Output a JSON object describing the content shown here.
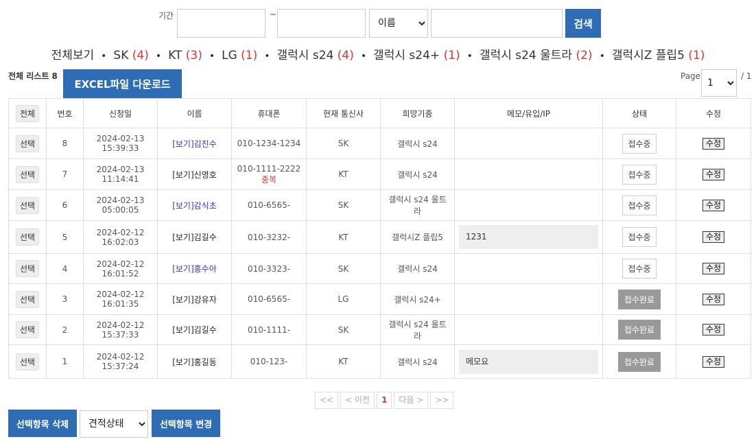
{
  "search": {
    "period_label": "기간",
    "tilde": "~",
    "start_value": "",
    "end_value": "",
    "field_selected": "이름",
    "field_options": [
      "이름"
    ],
    "keyword_value": "",
    "search_button": "검색"
  },
  "filters": [
    {
      "label": "전체보기",
      "count": ""
    },
    {
      "label": "SK",
      "count": "(4)"
    },
    {
      "label": "KT",
      "count": "(3)"
    },
    {
      "label": "LG",
      "count": "(1)"
    },
    {
      "label": "갤럭시 s24",
      "count": "(4)"
    },
    {
      "label": "갤럭시 s24+",
      "count": "(1)"
    },
    {
      "label": "갤럭시 s24 울트라",
      "count": "(2)"
    },
    {
      "label": "갤럭시Z 플립5",
      "count": "(1)"
    }
  ],
  "filter_separator": "•",
  "list_info": {
    "label": "전체 리스트 8",
    "excel_button": "EXCEL파일 다운로드"
  },
  "page_info": {
    "label": "Page",
    "current": "1",
    "total": "/ 1"
  },
  "table": {
    "headers": {
      "select": "전체",
      "no": "번호",
      "date": "신청일",
      "name": "이름",
      "phone": "휴대폰",
      "carrier": "현재 통신사",
      "model": "희망기종",
      "memo": "메모/유입/IP",
      "status": "상태",
      "edit": "수정"
    },
    "select_label": "선택",
    "edit_label": "수정",
    "rows": [
      {
        "no": "8",
        "date": "2024-02-13",
        "time": "15:39:33",
        "name": "[보기]김진수",
        "name_link": true,
        "phone": "010-1234-1234",
        "dup": "",
        "carrier": "SK",
        "model": "갤럭시 s24",
        "memo": "",
        "status": "접수중",
        "done": false
      },
      {
        "no": "7",
        "date": "2024-02-13",
        "time": "11:14:41",
        "name": "[보기]신영호",
        "name_link": false,
        "phone": "010-1111-2222",
        "dup": "중복",
        "carrier": "KT",
        "model": "갤럭시 s24",
        "memo": "",
        "status": "접수중",
        "done": false
      },
      {
        "no": "6",
        "date": "2024-02-13",
        "time": "05:00:05",
        "name": "[보기]감식초",
        "name_link": true,
        "phone": "010-6565-",
        "dup": "",
        "carrier": "SK",
        "model": "갤럭시 s24 울트라",
        "memo": "",
        "status": "접수중",
        "done": false
      },
      {
        "no": "5",
        "date": "2024-02-12",
        "time": "16:02:03",
        "name": "[보기]김길수",
        "name_link": false,
        "phone": "010-3232-",
        "dup": "",
        "carrier": "KT",
        "model": "갤럭시Z 플립5",
        "memo": "1231",
        "status": "접수중",
        "done": false
      },
      {
        "no": "4",
        "date": "2024-02-12",
        "time": "16:01:52",
        "name": "[보기]홍수아",
        "name_link": true,
        "phone": "010-3323-",
        "dup": "",
        "carrier": "SK",
        "model": "갤럭시 s24",
        "memo": "",
        "status": "접수중",
        "done": false
      },
      {
        "no": "3",
        "date": "2024-02-12",
        "time": "16:01:35",
        "name": "[보기]강유자",
        "name_link": false,
        "phone": "010-6565-",
        "dup": "",
        "carrier": "LG",
        "model": "갤럭시 s24+",
        "memo": "",
        "status": "접수완료",
        "done": true
      },
      {
        "no": "2",
        "date": "2024-02-12",
        "time": "15:37:33",
        "name": "[보기]김길수",
        "name_link": false,
        "phone": "010-1111-",
        "dup": "",
        "carrier": "SK",
        "model": "갤럭시 s24 울트라",
        "memo": "",
        "status": "접수완료",
        "done": true
      },
      {
        "no": "1",
        "date": "2024-02-12",
        "time": "15:37:24",
        "name": "[보기]홍길동",
        "name_link": false,
        "phone": "010-123-",
        "dup": "",
        "carrier": "KT",
        "model": "갤럭시 s24",
        "memo": "메모요",
        "status": "접수완료",
        "done": true
      }
    ]
  },
  "pagination": {
    "first": "<<",
    "prev": "< 이전",
    "current": "1",
    "next": "다음 >",
    "last": ">>"
  },
  "bottom": {
    "delete_button": "선택항목 삭제",
    "status_selected": "견적상태",
    "status_options": [
      "견적상태"
    ],
    "change_button": "선택항목 변경"
  }
}
